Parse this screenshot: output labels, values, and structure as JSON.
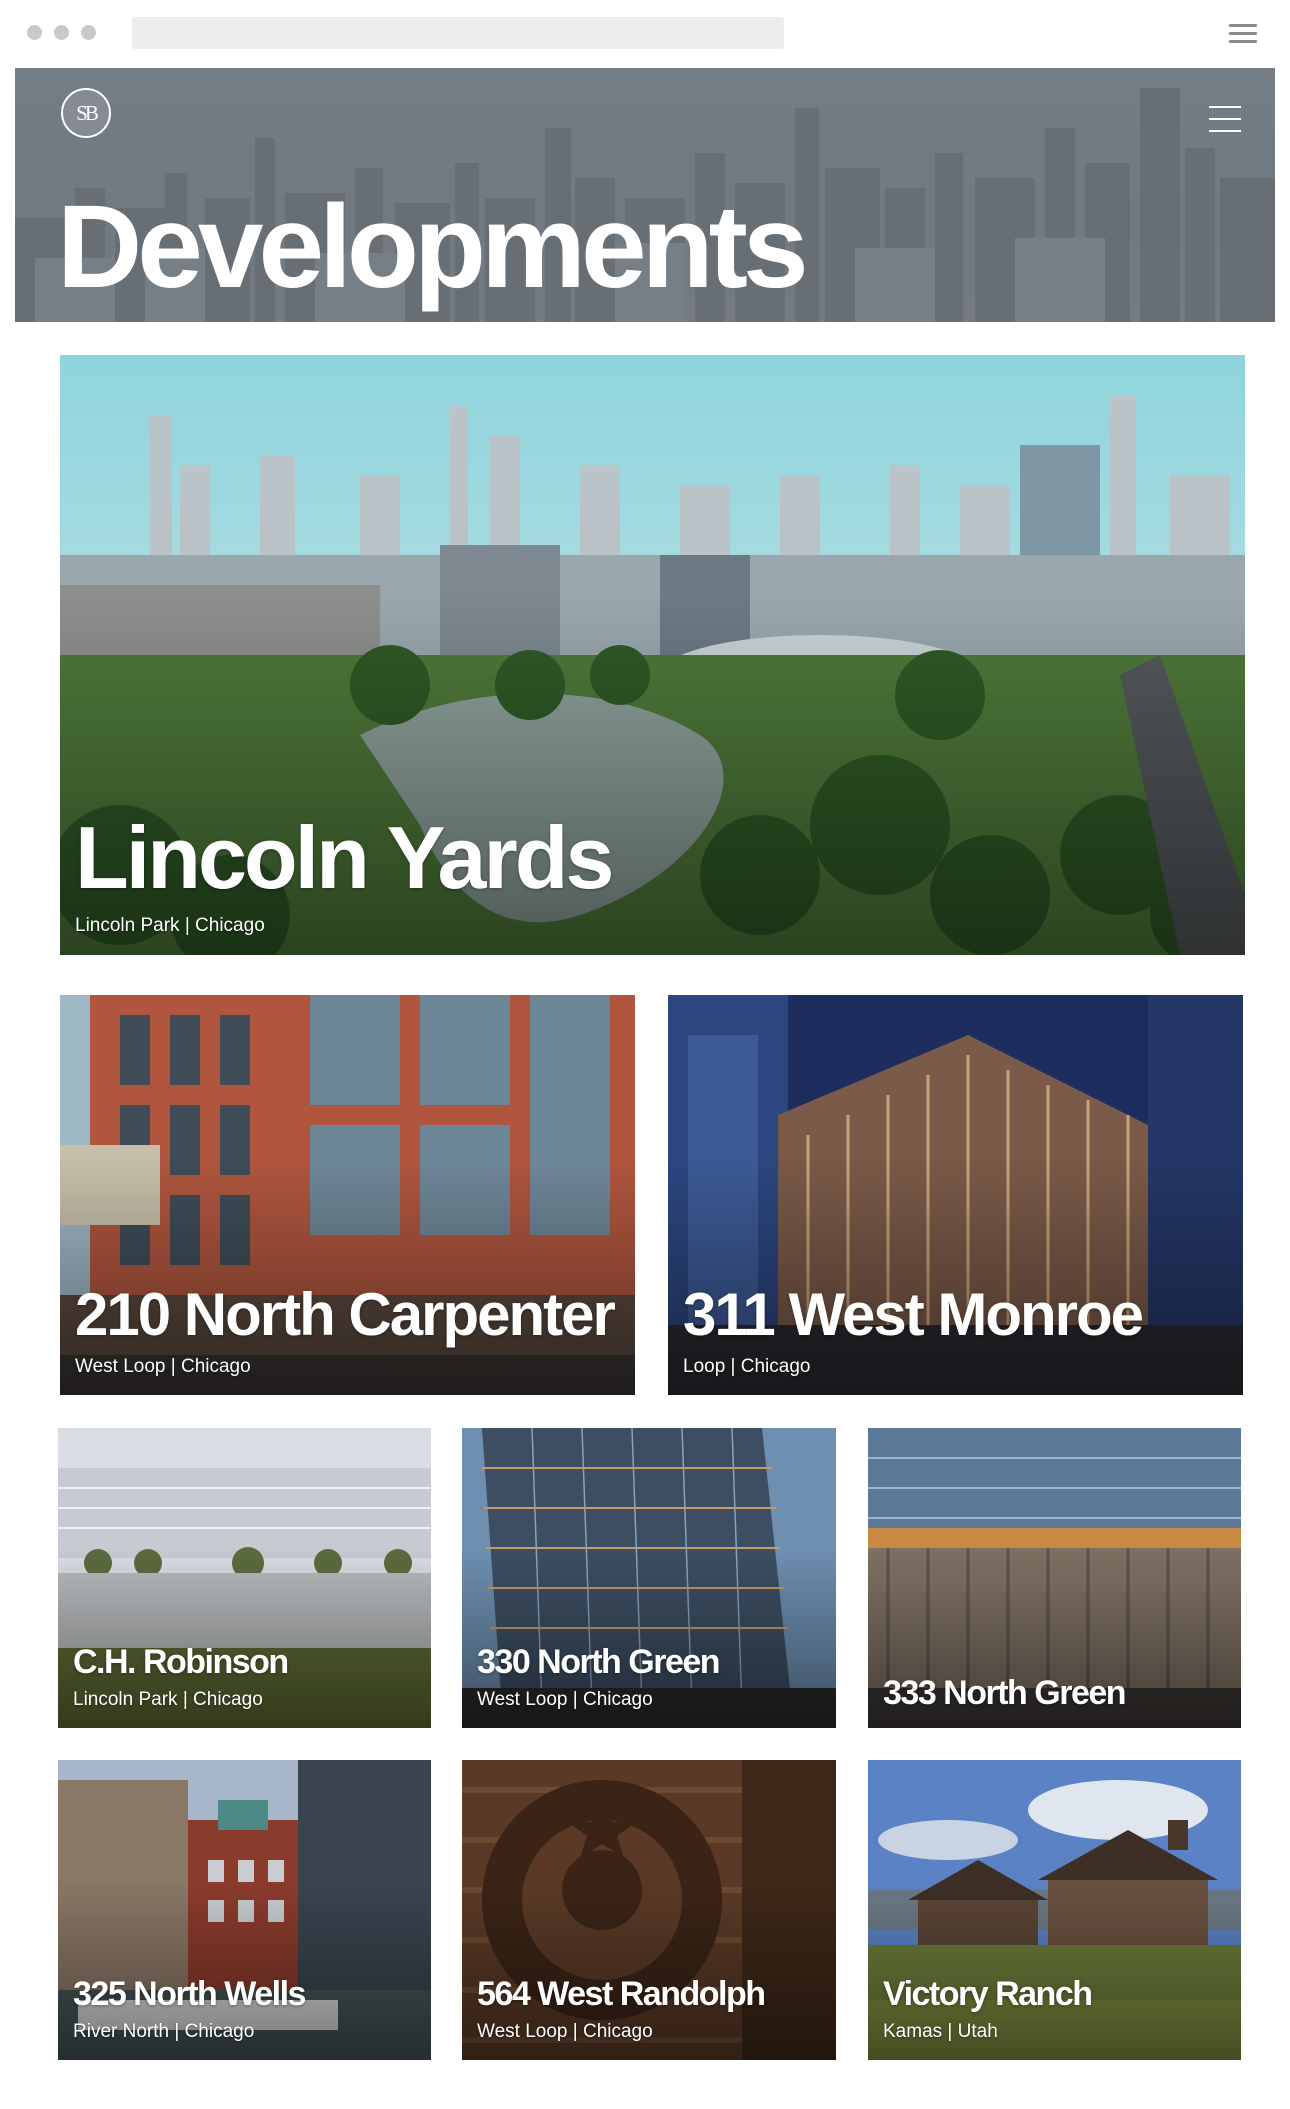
{
  "browser": {
    "address_text": ""
  },
  "header": {
    "logo_text": "SB",
    "title": "Developments"
  },
  "projects": [
    {
      "name": "Lincoln Yards",
      "location": "Lincoln Park | Chicago"
    },
    {
      "name": "210 North Carpenter",
      "location": "West Loop | Chicago"
    },
    {
      "name": "311 West Monroe",
      "location": "Loop | Chicago"
    },
    {
      "name": "C.H. Robinson",
      "location": "Lincoln Park | Chicago"
    },
    {
      "name": "330 North Green",
      "location": "West Loop | Chicago"
    },
    {
      "name": "333 North Green",
      "location": ""
    },
    {
      "name": "325 North Wells",
      "location": "River North | Chicago"
    },
    {
      "name": "564 West Randolph",
      "location": "West Loop | Chicago"
    },
    {
      "name": "Victory Ranch",
      "location": "Kamas | Utah"
    }
  ],
  "icons": [
    "menu-icon",
    "hamburger-menu-icon",
    "sb-logo"
  ],
  "colors": {
    "text": "#ffffff",
    "header_tint": "#7b848b",
    "page_bg": "#ffffff"
  }
}
